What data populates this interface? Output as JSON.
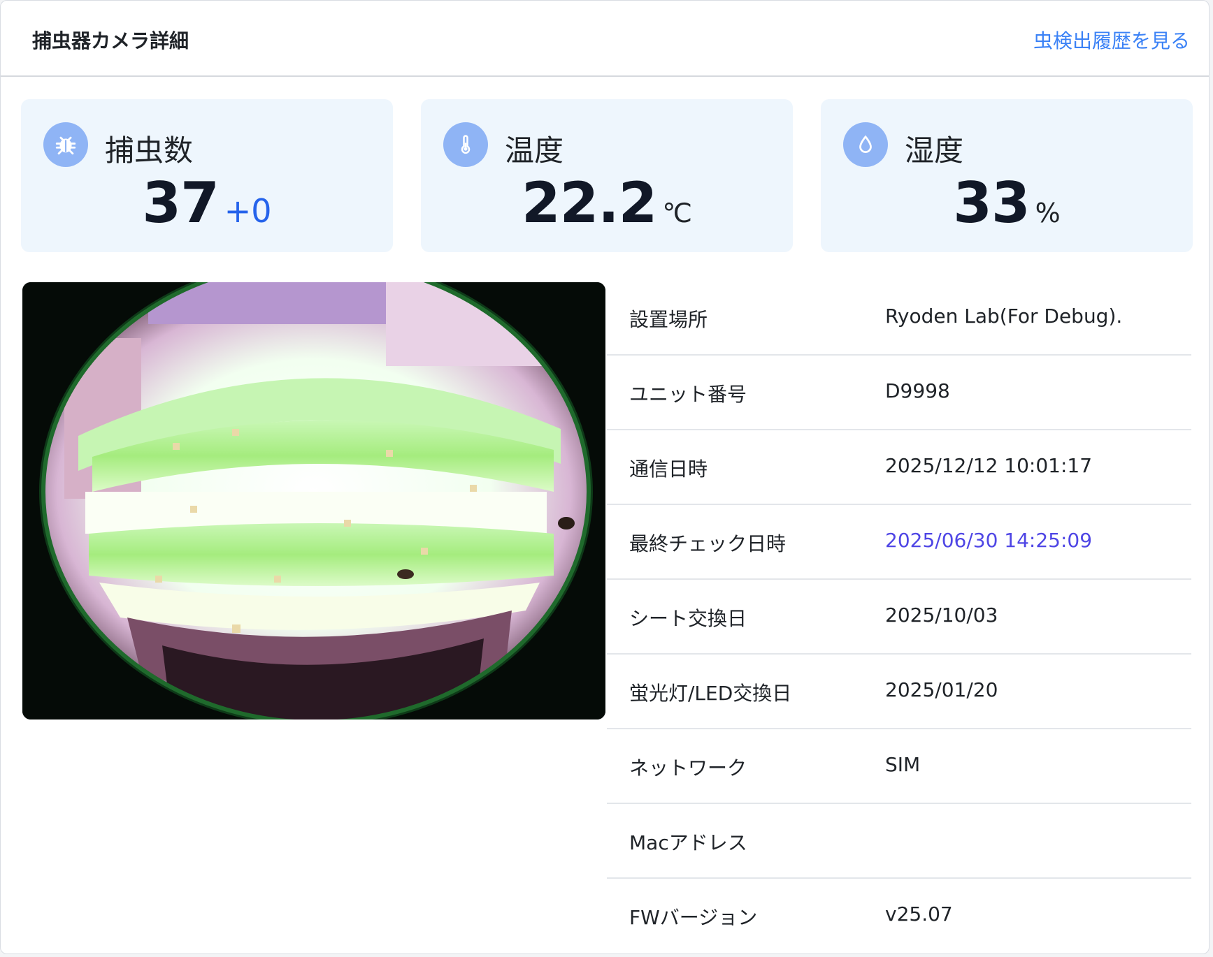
{
  "header": {
    "title": "捕虫器カメラ詳細",
    "history_link": "虫検出履歴を見る"
  },
  "stats": {
    "insects": {
      "label": "捕虫数",
      "value": "37",
      "delta": "+0",
      "icon": "bug-icon"
    },
    "temperature": {
      "label": "温度",
      "value": "22.2",
      "unit": "℃",
      "icon": "thermometer-icon"
    },
    "humidity": {
      "label": "湿度",
      "value": "33",
      "unit": "%",
      "icon": "water-drop-icon"
    }
  },
  "details": {
    "location": {
      "label": "設置場所",
      "value": "Ryoden Lab(For Debug)."
    },
    "unit_number": {
      "label": "ユニット番号",
      "value": "D9998"
    },
    "comm_datetime": {
      "label": "通信日時",
      "value": "2025/12/12 10:01:17"
    },
    "last_check": {
      "label": "最終チェック日時",
      "value": "2025/06/30 14:25:09"
    },
    "sheet_replaced": {
      "label": "シート交換日",
      "value": "2025/10/03"
    },
    "lamp_replaced": {
      "label": "蛍光灯/LED交換日",
      "value": "2025/01/20"
    },
    "network": {
      "label": "ネットワーク",
      "value": "SIM"
    },
    "mac_address": {
      "label": "Macアドレス",
      "value": ""
    },
    "fw_version": {
      "label": "FWバージョン",
      "value": "v25.07"
    }
  },
  "colors": {
    "accent": "#3b82f6",
    "link_purple": "#4f46e5",
    "card_bg": "#eef6fd",
    "icon_bg": "#8fb4f5"
  }
}
